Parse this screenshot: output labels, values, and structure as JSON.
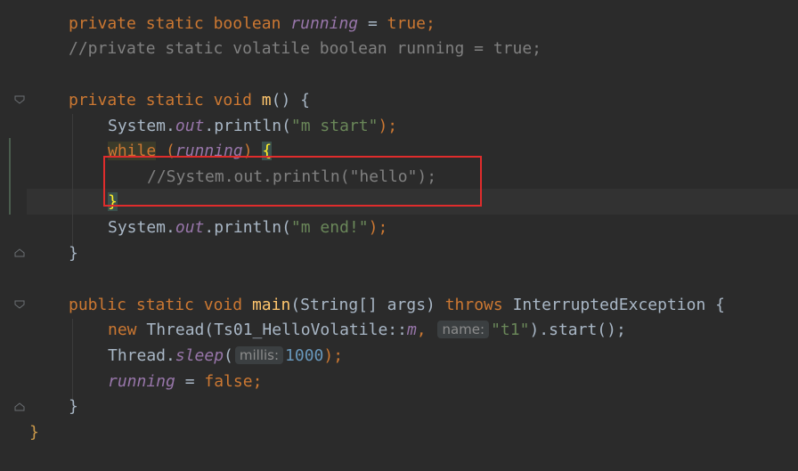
{
  "editor": {
    "lines": {
      "l1": {
        "mod1": "private",
        "mod2": "static",
        "type": "boolean",
        "field": "running",
        "eq": " = ",
        "val": "true",
        "semi": ";"
      },
      "l2": {
        "comment": "//private static volatile boolean running = true;"
      },
      "l4": {
        "mod1": "private",
        "mod2": "static",
        "type": "void",
        "name": "m",
        "rest": "() {"
      },
      "l5": {
        "cls": "System.",
        "field": "out",
        "call": ".println(",
        "str": "\"m start\"",
        "end": ");"
      },
      "l6": {
        "kw": "while",
        "open": " (",
        "field": "running",
        "close": ") ",
        "brace": "{"
      },
      "l7": {
        "comment": "//System.out.println(\"hello\");"
      },
      "l8": {
        "brace": "}"
      },
      "l9": {
        "cls": "System.",
        "field": "out",
        "call": ".println(",
        "str": "\"m end!\"",
        "end": ");"
      },
      "l10": {
        "brace": "}"
      },
      "l12": {
        "mod1": "public",
        "mod2": "static",
        "type": "void",
        "name": "main",
        "params": "(String[] args) ",
        "throws": "throws",
        "exc": " InterruptedException {"
      },
      "l13": {
        "kw": "new",
        "cls": " Thread(Ts01_HelloVolatile::",
        "method": "m",
        "comma": ",",
        "hint": "name:",
        "str": "\"t1\"",
        "end": ").start();"
      },
      "l14": {
        "cls": "Thread.",
        "method": "sleep",
        "open": "(",
        "hint": "millis:",
        "num": "1000",
        "end": ");"
      },
      "l15": {
        "field": "running",
        "eq": " = ",
        "val": "false",
        "semi": ";"
      },
      "l16": {
        "brace": "}"
      },
      "l17": {
        "brace": "}"
      }
    }
  },
  "colors": {
    "background": "#2b2b2b",
    "keyword": "#cc7832",
    "field": "#9876aa",
    "string": "#6a8759",
    "number": "#6897bb",
    "comment": "#808080",
    "annotation_box": "#e02c2c"
  },
  "icons": [
    "fold-marker-icon"
  ]
}
